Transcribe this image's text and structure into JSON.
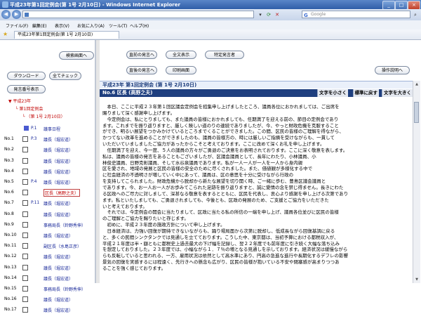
{
  "window": {
    "title": "平成23年第1回定例会(第 1号 2月10日) - Windows Internet Explorer",
    "controls": [
      "_",
      "□",
      "×"
    ]
  },
  "addressbar": {
    "back": "◀",
    "forward": "▶",
    "url": "",
    "search_placeholder": "Google",
    "search_brand": "G"
  },
  "menu": [
    "ファイル(F)",
    "編集(E)",
    "表示(V)",
    "お気に入り(A)",
    "ツール(T)",
    "ヘルプ(H)"
  ],
  "tab": {
    "title": "平成23年第1回定例会(第 1号 2月10日)"
  },
  "left": {
    "search_screen_button": "検索画面へ",
    "download_button": "ダウンロード",
    "check_all_button": "全てチェック",
    "speakers_button": "発言番号表示",
    "tree": {
      "year": "平成23年",
      "session": "第1回定例会",
      "meeting": "（第 1号 2月10日）"
    },
    "rows": [
      {
        "no": "",
        "page": "P.1",
        "who": "議事日程"
      },
      {
        "no": "No.1",
        "page": "P.3",
        "who": "議長（堀宏道）"
      },
      {
        "no": "No.2",
        "page": "",
        "who": "議長（堀宏道）"
      },
      {
        "no": "No.3",
        "page": "",
        "who": "議長（堀宏道）"
      },
      {
        "no": "No.4",
        "page": "",
        "who": "議長（堀宏道）"
      },
      {
        "no": "No.5",
        "page": "P.4",
        "who": "議長（堀宏道）"
      },
      {
        "no": "No.6",
        "page": "",
        "who": "区長（高野之夫）"
      },
      {
        "no": "No.7",
        "page": "P.11",
        "who": "議長（堀宏道）"
      },
      {
        "no": "No.8",
        "page": "",
        "who": "議長（堀宏道）"
      },
      {
        "no": "No.9",
        "page": "",
        "who": "事務局長（鈴野秀伸）"
      },
      {
        "no": "No.10",
        "page": "",
        "who": "議長（堀宏道）"
      },
      {
        "no": "No.11",
        "page": "",
        "who": "副区長（水島正彦）"
      },
      {
        "no": "No.12",
        "page": "",
        "who": "議長（堀宏道）"
      },
      {
        "no": "No.13",
        "page": "",
        "who": "議長（堀宏道）"
      },
      {
        "no": "No.14",
        "page": "",
        "who": "議長（堀宏道）"
      },
      {
        "no": "No.15",
        "page": "",
        "who": "事務局長（鈴野秀伸）"
      },
      {
        "no": "No.16",
        "page": "",
        "who": "議長（堀宏道）"
      },
      {
        "no": "No.17",
        "page": "",
        "who": "議長（堀宏道）"
      }
    ]
  },
  "right": {
    "prev_statement": "直前の発言へ",
    "full_display": "全文表示",
    "specific_speaker": "特定発言者",
    "next_statement": "直後の発言へ",
    "print_screen": "印刷画面",
    "operation_help": "操作説明へ",
    "header": "平成23年 第1回定例会 (第 1号 2月10日)",
    "speaker_header": "No.6 区長 (高野之夫)",
    "font_small": "文字を小さく",
    "font_reset": "標準に戻す",
    "font_large": "文字を大きく",
    "body": "　本日、ここに平成２３年第１回区議会定例会を招集申し上げましたところ、議員各位におかれましては、ご出席を\n賜りまして深く感謝申し上げます。\n　今定例会は、私にとりましても、また議員の皆様におかれましても、任期満了を迎える前の、節目の定例会であり\nます。これまでを振り返りますと、厳しく険しい道のりの連続でありましたが、今、やっと財政危機を克服すること\nができ、明るい展望をつかみかけているところまでくることができました。この間、区民の皆様のご理解を得ながら、\nかつてない改革を進めることができましたのも、議員の皆様方の、時には厳しいご指摘を受けながらも、一貫して\nいただいていましましたご協力があったからこそと考えております。ここに改めて深くお礼を申し上げます。\n　任期満了を迎え、今一度、５人の議員の方々がご勇退のご決意をお表明されております。ここに深く敬意を表します。\n私は、議員の皆様の発言をあることもございましたが、区議会議員として、長年にわたり、小林議員、小\n林俊史議員、日野克彰議員、そして水谷泉議員であります。私が一人一人が一人を一人から身内親\n区を愛され、地域の発展と区民の皆様の安全のために尽くされました。また、価値観が多様化する中で\nに社会経済の不透明さが増していく中にあって、議員は、区の意思を十分に受けながら行政の\nを支持してこられました。財政危機から脱却から新たな展望を切り開く時、ご一緒に歩む、豊島区議会議員と\nであります。今、お一人お一人がお歩みてこられた足跡を振り返りますと、誠に愛情の念を禁じ得ません。長きにわた\nる区政へのご尽力に対しまして、深甚なる敬意を表するとともに、区民を代表し、衷心より感謝を申し上げる次第であり\nます。私といたしましても、ご勇退されましても、今後とも、区政の発展のため、ご支援とご協力をいただきた\nいと考えております。\n　それでは、今定例会の開会に当たりまして、区政に当たる私の所信の一端を申し上げ、議員各位並びに区民の皆様\nのご理解とご協力を賜りたいと存じます。\n　初めに、平成２３年度の施政方針について申し上げます。\n　日本経済は、力強い回復が期待できないながらも、踊り場局面から次第に脱却し、低成長ながら回復基調に戻る\nと、多くの民間シンクタンクでは見通しを立てております。こうした中、東京都は、当初予算における都税収入が、\n平成２１年度は半・額ともに都税史上過去最大の下げ幅を記録し、翌２２年度でも前年度に引き続く大幅な落ち込み\nを想定しておりました。２３年度では、小幅ながら１．７％の増となる見通しを示しております。経済状況は緩慢ながら\nらも反転していると思われる、一方、雇用状況は依然として高水準にあり、円高の急進な進行や長期化するデフレの影響\n景気の回復を実感するには程遠く、先行きへの懸念も広がり、区民の皆様が抱いている不安や閉塞感が高まりつつあ\nることを強く感じております。"
  }
}
